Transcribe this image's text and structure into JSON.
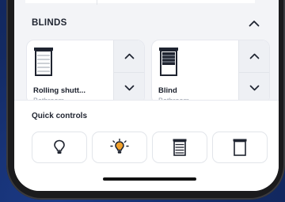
{
  "colors": {
    "background": "#132a63",
    "screen": "#f3f4f7",
    "card": "#ffffff",
    "text_primary": "#1a1f2b",
    "text_secondary": "#9aa0ab",
    "icon": "#1f2430",
    "bulb_on": "#f2a12b"
  },
  "blinds": {
    "section_title": "BLINDS",
    "collapse_icon": "chevron-up-icon",
    "devices": [
      {
        "name": "Rolling shutt...",
        "room": "Bathroom",
        "icon": "rolling-shutter-icon"
      },
      {
        "name": "Blind",
        "room": "Bathroom",
        "icon": "blind-icon"
      }
    ]
  },
  "quick_controls": {
    "title": "Quick controls",
    "buttons": [
      {
        "icon": "bulb-off-icon"
      },
      {
        "icon": "bulb-on-icon"
      },
      {
        "icon": "shutter-closed-icon"
      },
      {
        "icon": "shutter-open-icon"
      }
    ]
  }
}
